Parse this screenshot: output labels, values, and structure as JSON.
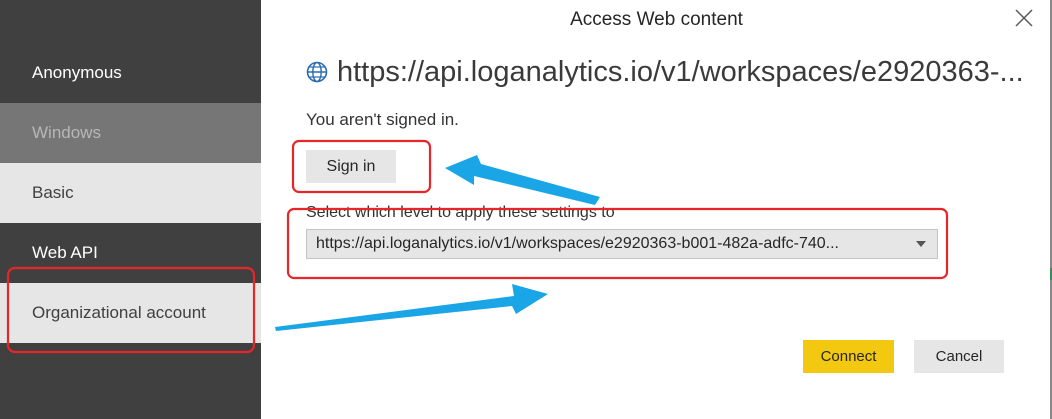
{
  "sidebar": {
    "items": [
      {
        "label": "Anonymous"
      },
      {
        "label": "Windows"
      },
      {
        "label": "Basic"
      },
      {
        "label": "Web API"
      },
      {
        "label": "Organizational account"
      }
    ]
  },
  "dialog": {
    "title": "Access Web content",
    "url": "https://api.loganalytics.io/v1/workspaces/e2920363-...",
    "status": "You aren't signed in.",
    "sign_in_label": "Sign in",
    "level_label": "Select which level to apply these settings to",
    "level_selected": "https://api.loganalytics.io/v1/workspaces/e2920363-b001-482a-adfc-740...",
    "connect_label": "Connect",
    "cancel_label": "Cancel"
  },
  "icons": {
    "close": "close-icon",
    "globe": "globe-icon",
    "dropdown": "chevron-down-icon"
  },
  "colors": {
    "sidebar_bg": "#404040",
    "sidebar_selected_bg": "#e6e6e6",
    "sidebar_disabled_bg": "#767676",
    "connect_accent": "#f2c811",
    "annotation_box": "#e8262a",
    "annotation_arrow": "#1aa6e6"
  }
}
